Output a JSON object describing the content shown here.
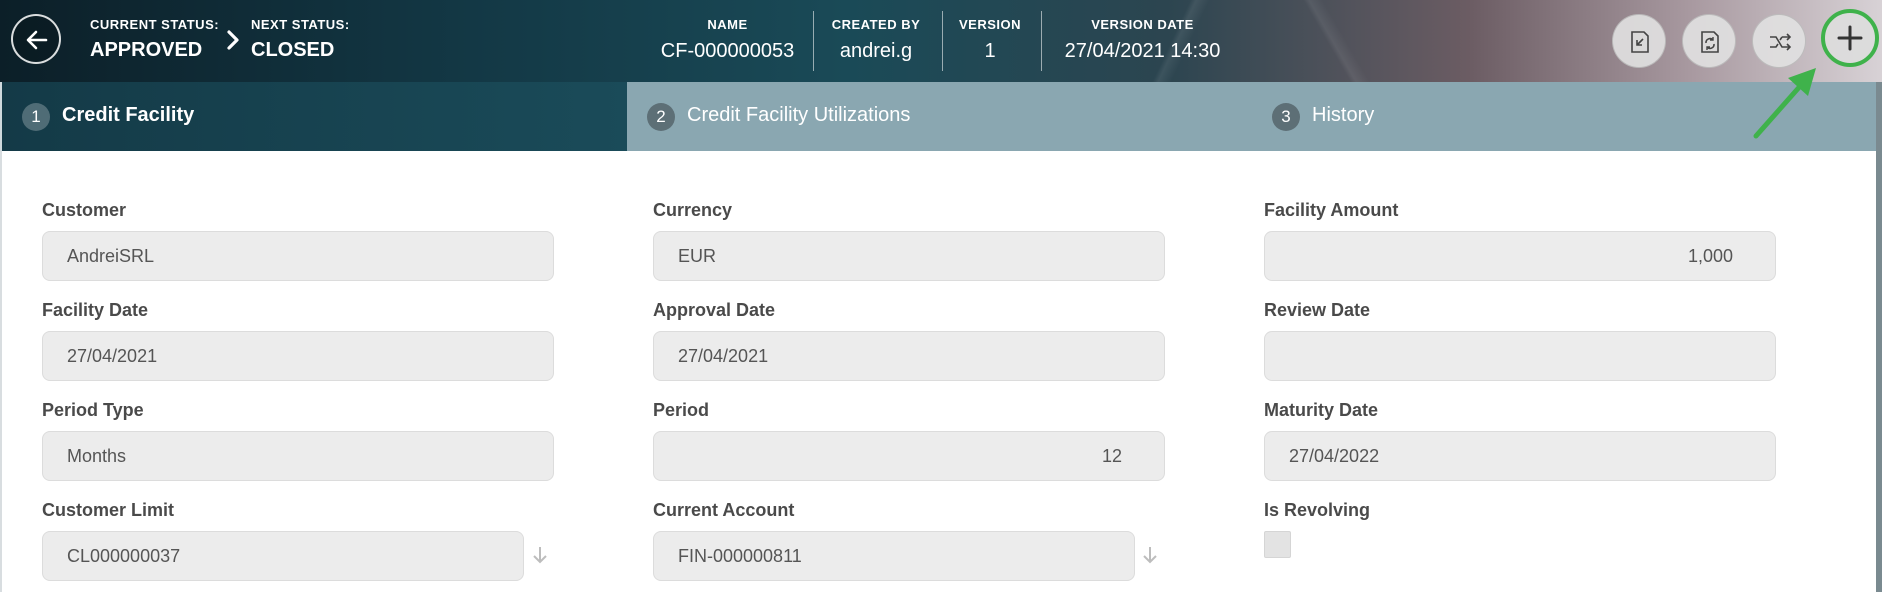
{
  "header": {
    "current_status_label": "CURRENT STATUS:",
    "current_status_value": "APPROVED",
    "next_status_label": "NEXT STATUS:",
    "next_status_value": "CLOSED",
    "name_label": "NAME",
    "name_value": "CF-000000053",
    "created_by_label": "CREATED BY",
    "created_by_value": "andrei.g",
    "version_label": "VERSION",
    "version_value": "1",
    "version_date_label": "VERSION DATE",
    "version_date_value": "27/04/2021 14:30",
    "icons": [
      "arrow-left-icon",
      "chevron-right-icon",
      "import-icon",
      "refresh-icon",
      "compare-icon",
      "plus-icon"
    ],
    "highlight_color": "#3fb24b"
  },
  "tabs": [
    {
      "number": "1",
      "label": "Credit Facility",
      "active": true
    },
    {
      "number": "2",
      "label": "Credit Facility Utilizations",
      "active": false
    },
    {
      "number": "3",
      "label": "History",
      "active": false
    }
  ],
  "form": {
    "customer": {
      "label": "Customer",
      "value": "AndreiSRL"
    },
    "currency": {
      "label": "Currency",
      "value": "EUR"
    },
    "facility_amount": {
      "label": "Facility Amount",
      "value": "1,000"
    },
    "facility_date": {
      "label": "Facility Date",
      "value": "27/04/2021"
    },
    "approval_date": {
      "label": "Approval Date",
      "value": "27/04/2021"
    },
    "review_date": {
      "label": "Review Date",
      "value": ""
    },
    "period_type": {
      "label": "Period Type",
      "value": "Months"
    },
    "period": {
      "label": "Period",
      "value": "12"
    },
    "maturity_date": {
      "label": "Maturity Date",
      "value": "27/04/2022"
    },
    "customer_limit": {
      "label": "Customer Limit",
      "value": "CL000000037"
    },
    "current_account": {
      "label": "Current Account",
      "value": "FIN-000000811"
    },
    "is_revolving": {
      "label": "Is Revolving",
      "checked": false
    }
  }
}
